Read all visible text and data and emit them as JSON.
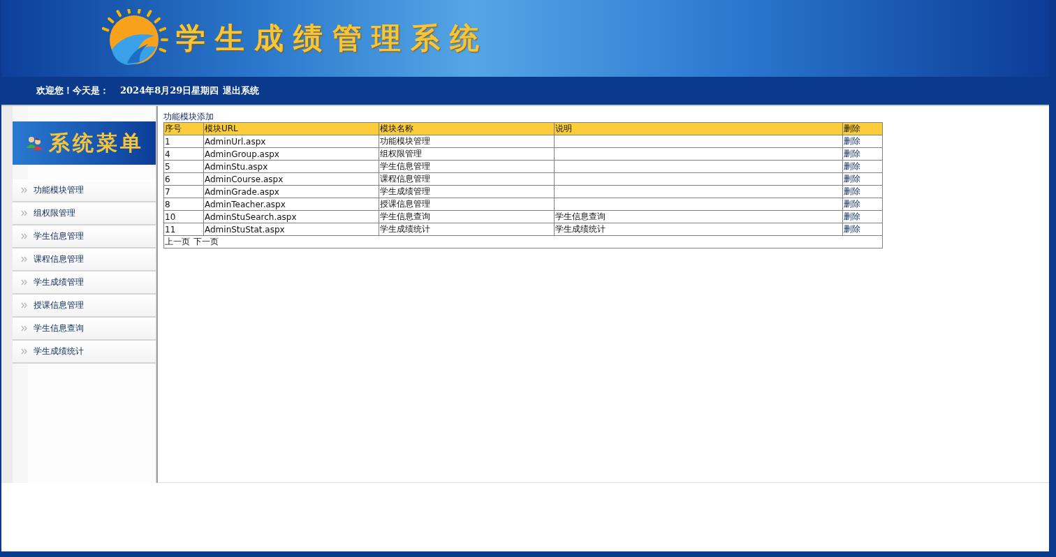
{
  "header": {
    "title": "学生成绩管理系统"
  },
  "welcome_bar": {
    "greeting": "欢迎您！今天是：",
    "date": "2024年8月29日星期四",
    "logout": "退出系统"
  },
  "sidebar": {
    "title": "系统菜单",
    "items": [
      {
        "label": "功能模块管理"
      },
      {
        "label": "组权限管理"
      },
      {
        "label": "学生信息管理"
      },
      {
        "label": "课程信息管理"
      },
      {
        "label": "学生成绩管理"
      },
      {
        "label": "授课信息管理"
      },
      {
        "label": "学生信息查询"
      },
      {
        "label": "学生成绩统计"
      }
    ]
  },
  "main": {
    "add_link": "功能模块添加",
    "table": {
      "columns": [
        "序号",
        "模块URL",
        "模块名称",
        "说明",
        "删除"
      ],
      "rows": [
        [
          "1",
          "AdminUrl.aspx",
          "功能模块管理",
          "",
          "删除"
        ],
        [
          "4",
          "AdminGroup.aspx",
          "组权限管理",
          "",
          "删除"
        ],
        [
          "5",
          "AdminStu.aspx",
          "学生信息管理",
          "",
          "删除"
        ],
        [
          "6",
          "AdminCourse.aspx",
          "课程信息管理",
          "",
          "删除"
        ],
        [
          "7",
          "AdminGrade.aspx",
          "学生成绩管理",
          "",
          "删除"
        ],
        [
          "8",
          "AdminTeacher.aspx",
          "授课信息管理",
          "",
          "删除"
        ],
        [
          "10",
          "AdminStuSearch.aspx",
          "学生信息查询",
          "学生信息查询",
          "删除"
        ],
        [
          "11",
          "AdminStuStat.aspx",
          "学生成绩统计",
          "学生成绩统计",
          "删除"
        ]
      ]
    },
    "pager": [
      "上一页",
      "下一页"
    ]
  }
}
